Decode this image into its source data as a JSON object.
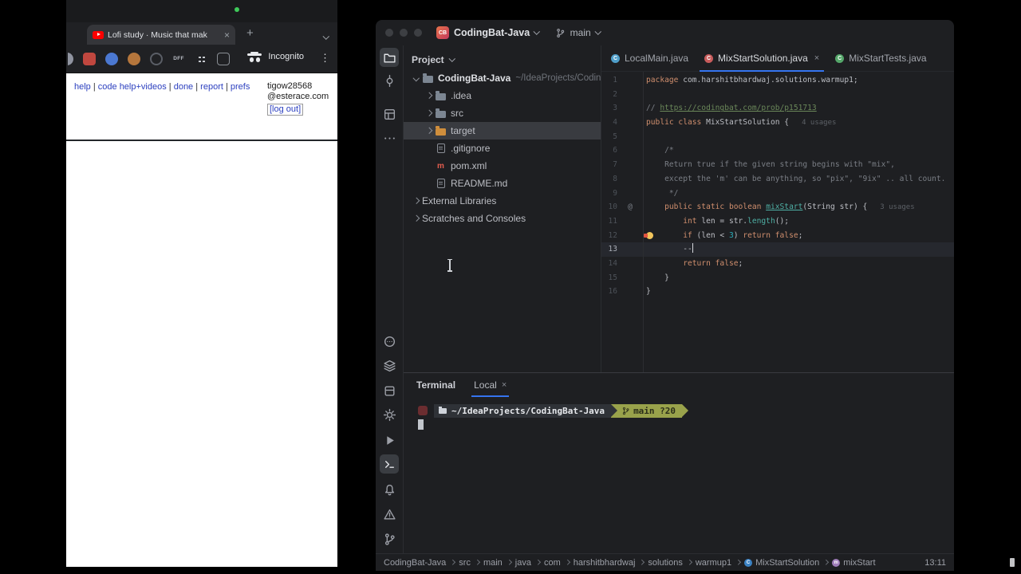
{
  "browser": {
    "window": {
      "tab_title": "Lofi study · Music that mak",
      "incognito_label": "Incognito"
    },
    "extensions": [
      {
        "kind": "half",
        "color": "#9094a0",
        "name": "extension-icon"
      },
      {
        "kind": "rounded",
        "color": "#c0473f",
        "name": "extension-icon"
      },
      {
        "kind": "circle",
        "color": "#4b78d1",
        "name": "extension-icon"
      },
      {
        "kind": "circle",
        "color": "#b5763c",
        "name": "extension-icon"
      },
      {
        "kind": "ring",
        "color": "#5a5e66",
        "name": "extension-icon"
      },
      {
        "kind": "text",
        "color": "#b8bcc4",
        "label": "DFF",
        "name": "extension-icon"
      },
      {
        "kind": "dots",
        "color": "#c7cacf",
        "name": "extension-icon"
      },
      {
        "kind": "outline",
        "color": "#8a8f95",
        "name": "extension-icon"
      }
    ],
    "page": {
      "nav_links": [
        "help",
        "code help+videos",
        "done",
        "report",
        "prefs"
      ],
      "nav_separator": "|",
      "username": "tigow28568",
      "email_domain": "@esterace.com",
      "logout_label": "[log out]"
    }
  },
  "ide": {
    "titlebar": {
      "project_badge": "CB",
      "project_name": "CodingBat-Java",
      "branch_name": "main"
    },
    "left_strip": {
      "top_icons": [
        "project",
        "commit",
        "structure",
        "more"
      ],
      "bottom_icons": [
        "profiler",
        "services",
        "build",
        "settings",
        "run",
        "terminal",
        "notifications",
        "problems",
        "git"
      ]
    },
    "project_panel": {
      "title": "Project",
      "tree": [
        {
          "indent": 0,
          "arrow": "down",
          "icon": "folder",
          "label": "CodingBat-Java",
          "bold": true,
          "extra": "~/IdeaProjects/CodingBat-Java"
        },
        {
          "indent": 1,
          "arrow": "right",
          "icon": "folder",
          "label": ".idea"
        },
        {
          "indent": 1,
          "arrow": "right",
          "icon": "folder",
          "label": "src"
        },
        {
          "indent": 1,
          "arrow": "right",
          "icon": "folder-excluded",
          "label": "target",
          "selected": true
        },
        {
          "indent": 1,
          "arrow": "none",
          "icon": "file",
          "label": ".gitignore"
        },
        {
          "indent": 1,
          "arrow": "none",
          "icon": "maven",
          "label": "pom.xml"
        },
        {
          "indent": 1,
          "arrow": "none",
          "icon": "file",
          "label": "README.md"
        },
        {
          "indent": 0,
          "arrow": "right",
          "icon": "none",
          "label": "External Libraries"
        },
        {
          "indent": 0,
          "arrow": "right",
          "icon": "none",
          "label": "Scratches and Consoles"
        }
      ]
    },
    "editor": {
      "tabs": [
        {
          "label": "LocalMain.java",
          "icon_color": "#4f9ec9",
          "icon_letter": "C",
          "active": false,
          "close": false
        },
        {
          "label": "MixStartSolution.java",
          "icon_color": "#c85c5c",
          "icon_letter": "C",
          "active": true,
          "close": true
        },
        {
          "label": "MixStartTests.java",
          "icon_color": "#55a76a",
          "icon_letter": "C",
          "active": false,
          "close": false
        }
      ],
      "code_lines": [
        {
          "n": 1,
          "t": [
            [
              "kw",
              "package "
            ],
            [
              "pl",
              "com.harshitbhardwaj.solutions.warmup1;"
            ]
          ]
        },
        {
          "n": 2,
          "t": []
        },
        {
          "n": 3,
          "t": [
            [
              "cmt",
              "// "
            ],
            [
              "lnk",
              "https://codingbat.com/prob/p151713"
            ]
          ]
        },
        {
          "n": 4,
          "t": [
            [
              "kw",
              "public class "
            ],
            [
              "pl",
              "MixStartSolution {"
            ]
          ],
          "inlay": "4 usages"
        },
        {
          "n": 5,
          "t": []
        },
        {
          "n": 6,
          "t": [
            [
              "cmt",
              "    /*"
            ]
          ]
        },
        {
          "n": 7,
          "t": [
            [
              "cmt",
              "    Return true if the given string begins with \"mix\","
            ]
          ]
        },
        {
          "n": 8,
          "t": [
            [
              "cmt",
              "    except the 'm' can be anything, so \"pix\", \"9ix\" .. all count."
            ]
          ]
        },
        {
          "n": 9,
          "t": [
            [
              "cmt",
              "     */"
            ]
          ]
        },
        {
          "n": 10,
          "t": [
            [
              "kw",
              "    public static boolean "
            ],
            [
              "meth",
              "mixStart"
            ],
            [
              "pl",
              "(String str) {"
            ]
          ],
          "inlay": "3 usages",
          "gutter": "@"
        },
        {
          "n": 11,
          "t": [
            [
              "kw",
              "        int "
            ],
            [
              "pl",
              "len = str."
            ],
            [
              "call",
              "length"
            ],
            [
              "pl",
              "();"
            ]
          ]
        },
        {
          "n": 12,
          "t": [
            [
              "kw",
              "        if "
            ],
            [
              "pl",
              "(len < "
            ],
            [
              "num",
              "3"
            ],
            [
              "pl",
              ") "
            ],
            [
              "kw",
              "return false"
            ],
            [
              "pl",
              ";"
            ]
          ],
          "bulb": true
        },
        {
          "n": 13,
          "t": [
            [
              "pl",
              "        --"
            ]
          ],
          "current": true,
          "caret": true
        },
        {
          "n": 14,
          "t": [
            [
              "kw",
              "        return false"
            ],
            [
              "pl",
              ";"
            ]
          ]
        },
        {
          "n": 15,
          "t": [
            [
              "pl",
              "    }"
            ]
          ]
        },
        {
          "n": 16,
          "t": [
            [
              "pl",
              "}"
            ]
          ]
        }
      ]
    },
    "terminal": {
      "panel_title": "Terminal",
      "tab_label": "Local",
      "prompt_path": "~/IdeaProjects/CodingBat-Java",
      "git_segment": "main ?20"
    },
    "status_bar": {
      "breadcrumbs": [
        {
          "label": "CodingBat-Java"
        },
        {
          "label": "src"
        },
        {
          "label": "main"
        },
        {
          "label": "java"
        },
        {
          "label": "com"
        },
        {
          "label": "harshitbhardwaj"
        },
        {
          "label": "solutions"
        },
        {
          "label": "warmup1"
        },
        {
          "label": "MixStartSolution",
          "icon": "class"
        },
        {
          "label": "mixStart",
          "icon": "method"
        }
      ],
      "caret_position": "13:11"
    }
  },
  "colors": {
    "ide_accent": "#3574f0",
    "keyword": "#cf8e6d",
    "number": "#2aacb8",
    "comment": "#7a7e85",
    "method": "#4fb0a5",
    "selection": "#393b40",
    "excluded_folder": "#cf8e3c",
    "incognito_bg": "#202124"
  }
}
